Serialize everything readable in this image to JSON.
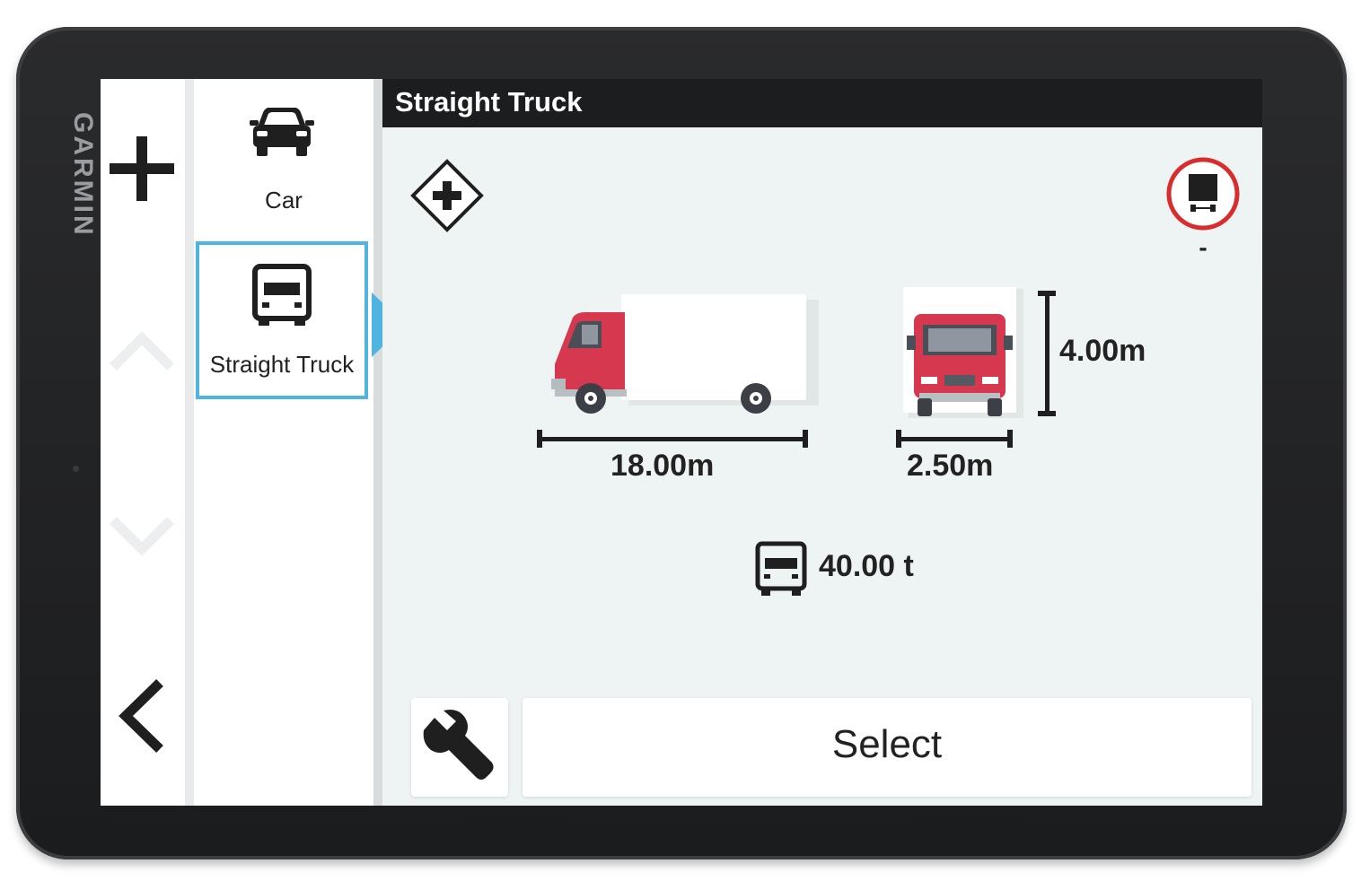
{
  "device": {
    "brand": "GARMIN"
  },
  "sidebar": {
    "items": [
      {
        "label": "Car",
        "icon": "car-icon",
        "selected": false
      },
      {
        "label": "Straight Truck",
        "icon": "truck-icon",
        "selected": true
      }
    ]
  },
  "main": {
    "title": "Straight Truck",
    "restriction_value": "-",
    "length": "18.00m",
    "width": "2.50m",
    "height": "4.00m",
    "weight": "40.00 t",
    "select_label": "Select"
  },
  "colors": {
    "accent": "#4fb4e0",
    "truck_red": "#d6384f",
    "restriction_red": "#d92c2c",
    "background": "#eef3f4"
  }
}
